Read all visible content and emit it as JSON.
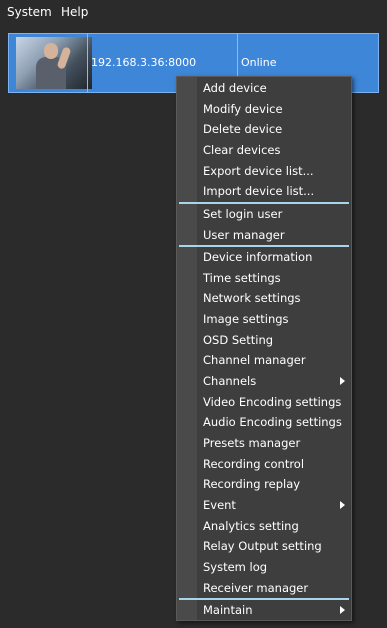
{
  "menubar": {
    "items": [
      "System",
      "Help"
    ]
  },
  "device": {
    "address": "192.168.3.36:8000",
    "status": "Online"
  },
  "context_menu": {
    "group1": [
      "Add device",
      "Modify device",
      "Delete device",
      "Clear devices",
      "Export device list...",
      "Import device list..."
    ],
    "group2": [
      "Set login user",
      "User manager"
    ],
    "group3": [
      "Device information",
      "Time settings",
      "Network settings",
      "Image settings",
      "OSD Setting",
      "Channel manager",
      "Channels",
      "Video Encoding settings",
      "Audio Encoding settings",
      "Presets manager",
      "Recording control",
      "Recording replay",
      "Event",
      "Analytics setting",
      "Relay Output setting",
      "System log",
      "Receiver manager"
    ],
    "group4": [
      "Maintain"
    ]
  },
  "colors": {
    "accent": "#3e86d8",
    "separator": "#a8d4ec",
    "background": "#2b2b2b",
    "menu_bg": "#3e3e3e"
  },
  "icons": {
    "submenu_arrow": "chevron-right-icon"
  }
}
